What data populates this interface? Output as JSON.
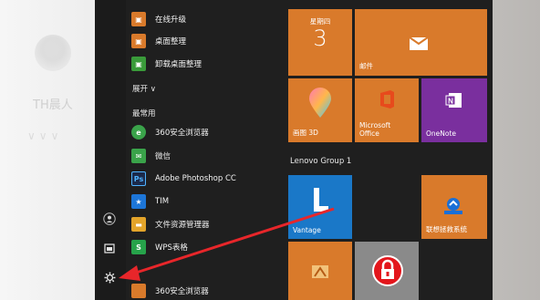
{
  "desktop": {
    "ghost_name": "TH晨人",
    "ghost_marks": "∨∨∨"
  },
  "app_list": {
    "items_top": [
      {
        "label": "在线升级",
        "icon": "upgrade-icon",
        "color": "#d97a2b"
      },
      {
        "label": "桌面整理",
        "icon": "desktop-organize-icon",
        "color": "#d97a2b"
      },
      {
        "label": "卸载桌面整理",
        "icon": "uninstall-icon",
        "color": "#3a9b3a"
      }
    ],
    "expand_label": "展开 ∨",
    "frequent_label": "最常用",
    "items": [
      {
        "label": "360安全浏览器",
        "icon": "360-browser-icon",
        "color": "#3aa34a",
        "glyph": "e"
      },
      {
        "label": "微信",
        "icon": "wechat-icon",
        "color": "#3aa34a",
        "glyph": "✉"
      },
      {
        "label": "Adobe Photoshop CC",
        "icon": "photoshop-icon",
        "color": "#1b2a4a",
        "glyph": "Ps"
      },
      {
        "label": "TIM",
        "icon": "tim-icon",
        "color": "#1d76d8",
        "glyph": "★"
      },
      {
        "label": "文件资源管理器",
        "icon": "file-explorer-icon",
        "color": "#e3a42a",
        "glyph": "▬"
      },
      {
        "label": "WPS表格",
        "icon": "wps-sheet-icon",
        "color": "#26a34a",
        "glyph": "S"
      },
      {
        "label": "360安全浏览器",
        "icon": "360-browser-icon",
        "color": "#d97a2b",
        "glyph": ""
      }
    ]
  },
  "tiles": {
    "calendar": {
      "day": "星期四",
      "date": "3"
    },
    "mail": {
      "label": "邮件"
    },
    "paint3d": {
      "label": "画图 3D"
    },
    "office": {
      "label": "Microsoft\nOffice"
    },
    "onenote": {
      "label": "OneNote"
    },
    "group_title": "Lenovo Group 1",
    "vantage": {
      "label": "Vantage"
    },
    "lenovo_rescue": {
      "label": "联想拯救系统"
    }
  },
  "colors": {
    "tile_orange": "#d97a2b",
    "onenote": "#7a2f9e",
    "vantage": "#1a78c8",
    "arrow": "#e8262a"
  }
}
